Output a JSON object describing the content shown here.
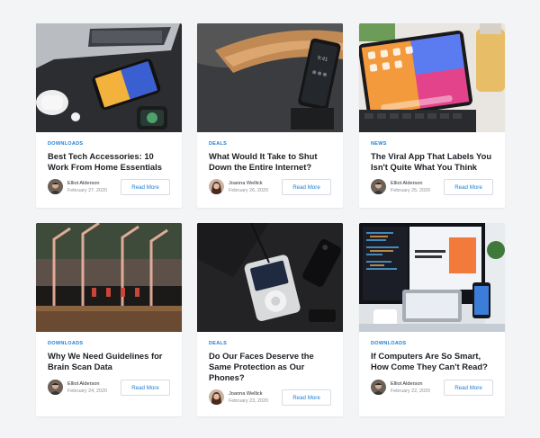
{
  "cards": [
    {
      "category": "DOWNLOADS",
      "title": "Best Tech Accessories: 10 Work From Home Essentials",
      "author": "Elliot Alderson",
      "date": "February 27, 2020",
      "button": "Read More"
    },
    {
      "category": "DEALS",
      "title": "What Would It Take to Shut Down the Entire Internet?",
      "author": "Joanna Wellick",
      "date": "February 26, 2020",
      "button": "Read More"
    },
    {
      "category": "NEWS",
      "title": "The Viral App That Labels You Isn't Quite What You Think",
      "author": "Elliot Alderson",
      "date": "February 25, 2020",
      "button": "Read More"
    },
    {
      "category": "DOWNLOADS",
      "title": "Why We Need Guidelines for Brain Scan Data",
      "author": "Elliot Alderson",
      "date": "February 24, 2020",
      "button": "Read More"
    },
    {
      "category": "DEALS",
      "title": "Do Our Faces Deserve the Same Protection as Our Phones?",
      "author": "Joanna Wellick",
      "date": "February 23, 2020",
      "button": "Read More"
    },
    {
      "category": "DOWNLOADS",
      "title": "If Computers Are So Smart, How Come They Can't Read?",
      "author": "Elliot Alderson",
      "date": "February 22, 2020",
      "button": "Read More"
    }
  ],
  "accent_color": "#1e7fd6"
}
